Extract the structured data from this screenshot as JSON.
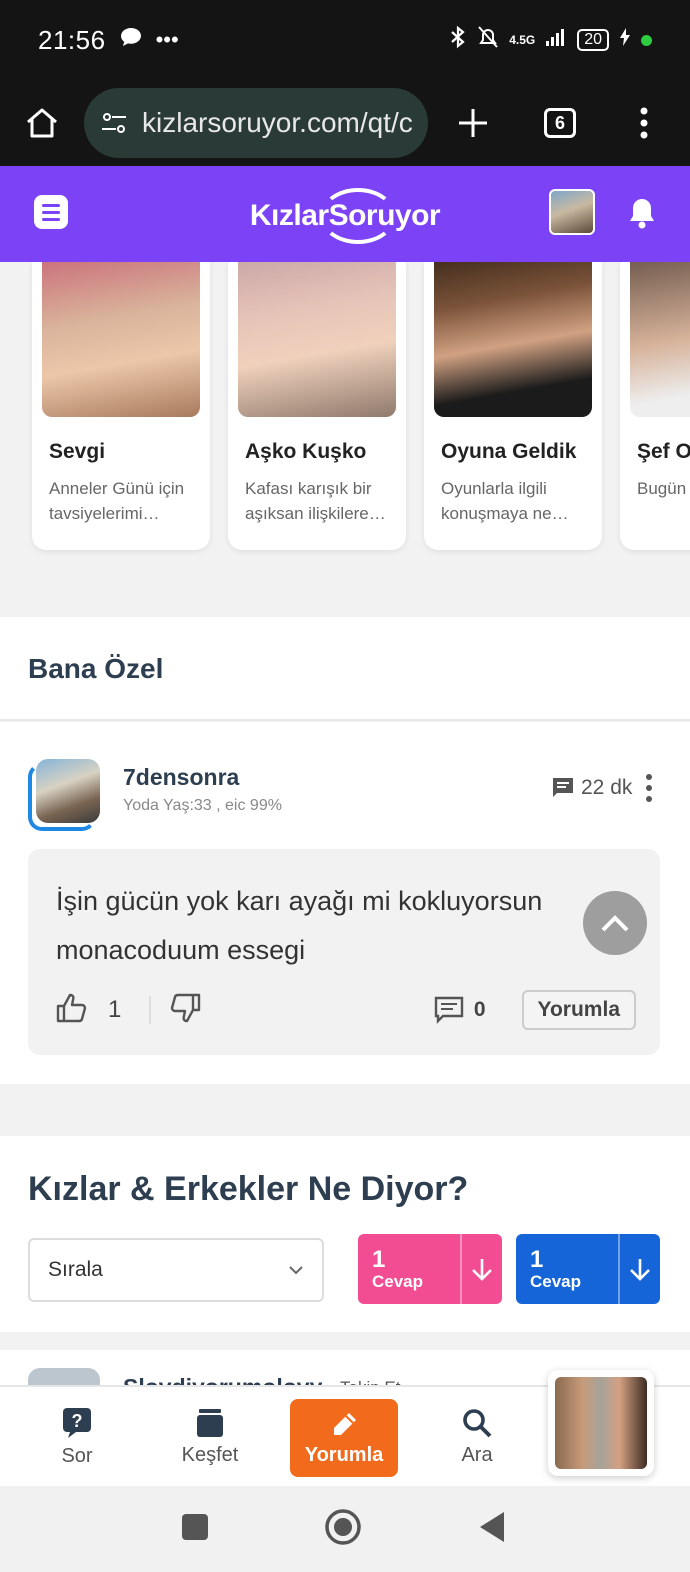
{
  "status_bar": {
    "time": "21:56",
    "battery": "20",
    "network": "4.5G"
  },
  "browser": {
    "url": "kizlarsoruyor.com/qt/c",
    "tab_count": "6"
  },
  "header": {
    "logo_text": "KızlarSoruyor",
    "accent_color": "#7b42f6"
  },
  "carousel": {
    "cards": [
      {
        "name": "Sevgi",
        "desc": "Anneler Günü için tavsiyelerimi…"
      },
      {
        "name": "Aşko Kuşko",
        "desc": "Kafası karışık bir aşıksan ilişkilere…"
      },
      {
        "name": "Oyuna Geldik",
        "desc": "Oyunlarla ilgili konuşmaya ne…"
      },
      {
        "name": "Şef O",
        "desc": "Bugün pişirme"
      }
    ]
  },
  "bana_ozel": {
    "title": "Bana Özel"
  },
  "post": {
    "username": "7densonra",
    "meta": "Yoda Yaş:33 , eic 99%",
    "time": "22 dk",
    "text": "İşin gücün yok karı ayağı mi kokluyorsun monacoduum essegi",
    "likes": "1",
    "comments": "0",
    "comment_button": "Yorumla"
  },
  "kizlar": {
    "title": "Kızlar & Erkekler Ne Diyor?",
    "sort_label": "Sırala",
    "female": {
      "count": "1",
      "label": "Cevap",
      "color": "#f24c93"
    },
    "male": {
      "count": "1",
      "label": "Cevap",
      "color": "#1565d8"
    }
  },
  "next_post": {
    "username": "Slovdiyorumolovy",
    "follow": "Takip Et"
  },
  "bottom_nav": {
    "sor": "Sor",
    "kesfet": "Keşfet",
    "yorumla": "Yorumla",
    "ara": "Ara"
  }
}
